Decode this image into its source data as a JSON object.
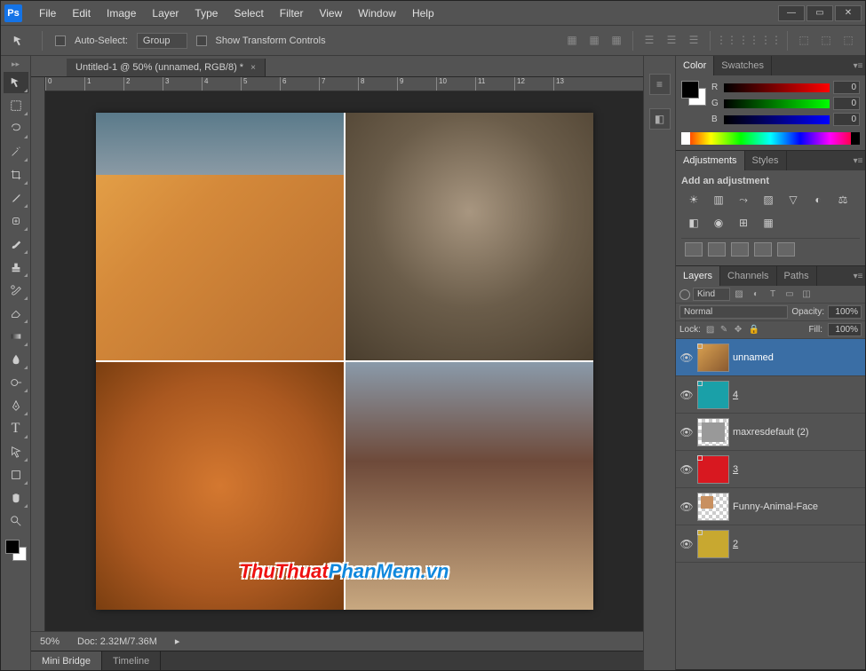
{
  "menu": [
    "File",
    "Edit",
    "Image",
    "Layer",
    "Type",
    "Select",
    "Filter",
    "View",
    "Window",
    "Help"
  ],
  "optbar": {
    "auto_select": "Auto-Select:",
    "group": "Group",
    "show_transform": "Show Transform Controls"
  },
  "doctab": "Untitled-1 @ 50% (unnamed, RGB/8) *",
  "ruler_h": [
    "0",
    "1",
    "2",
    "3",
    "4",
    "5",
    "6",
    "7",
    "8",
    "9",
    "10",
    "11",
    "12",
    "13"
  ],
  "watermark": {
    "part1": "ThuThuat",
    "part2": "PhanMem",
    "ext": ".vn"
  },
  "status": {
    "zoom": "50%",
    "doc": "Doc: 2.32M/7.36M"
  },
  "bottom_tabs": [
    "Mini Bridge",
    "Timeline"
  ],
  "panels": {
    "color_tab": "Color",
    "swatches_tab": "Swatches",
    "rgb": {
      "r": "R",
      "g": "G",
      "b": "B",
      "rv": "0",
      "gv": "0",
      "bv": "0"
    },
    "adjustments_tab": "Adjustments",
    "styles_tab": "Styles",
    "adj_title": "Add an adjustment",
    "layers_tab": "Layers",
    "channels_tab": "Channels",
    "paths_tab": "Paths",
    "kind": "Kind",
    "normal": "Normal",
    "opacity_lbl": "Opacity:",
    "opacity_val": "100%",
    "lock_lbl": "Lock:",
    "fill_lbl": "Fill:",
    "fill_val": "100%"
  },
  "layers": [
    {
      "name": "unnamed",
      "sel": true,
      "thumb": "photo"
    },
    {
      "name": "4",
      "thumb": "teal"
    },
    {
      "name": "maxresdefault (2)",
      "thumb": "checker"
    },
    {
      "name": "3",
      "thumb": "red"
    },
    {
      "name": "Funny-Animal-Face",
      "thumb": "checker2"
    },
    {
      "name": "2",
      "thumb": "yellow"
    }
  ]
}
